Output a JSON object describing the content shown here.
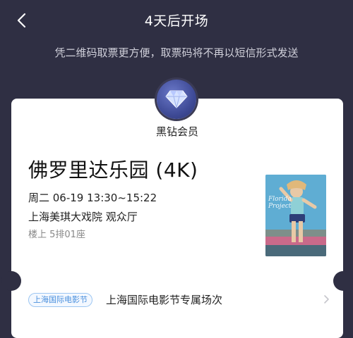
{
  "header": {
    "title": "4天后开场",
    "back_icon": "chevron-left-icon"
  },
  "notice": "凭二维码取票更方便，取票码将不再以短信形式发送",
  "member": {
    "badge_icon": "diamond-icon",
    "label": "黑钻会员"
  },
  "ticket": {
    "movie_title": "佛罗里达乐园 (4K)",
    "showtime": "周二 06-19 13:30~15:22",
    "cinema": "上海美琪大戏院 观众厅",
    "seat": "楼上 5排01座",
    "poster_icon": "movie-poster-image"
  },
  "festival": {
    "tag": "上海国际电影节",
    "text": "上海国际电影节专属场次",
    "chevron_icon": "chevron-right-icon"
  },
  "colors": {
    "background": "#2f2f43",
    "card": "#ffffff",
    "tag_blue": "#4b90dd"
  }
}
